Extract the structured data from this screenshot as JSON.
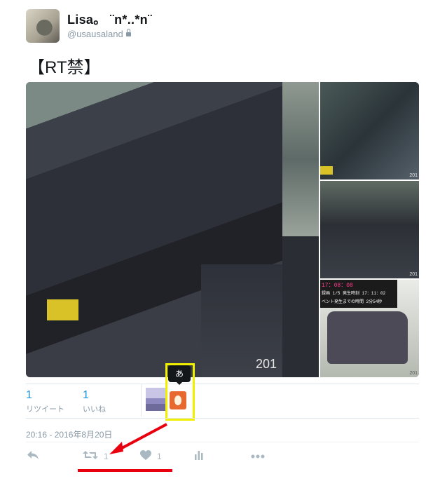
{
  "author": {
    "display_name": "Lisa。 ¨n*..*n¨",
    "handle": "@usausaland"
  },
  "tweet": {
    "text": "【RT禁】",
    "timestamp": "20:16 - 2016年8月20日"
  },
  "media": {
    "watermark_main": "201",
    "watermark_small_1": "201",
    "watermark_small_2": "201",
    "watermark_small_3": "201",
    "hud_line_1": "17：08：08",
    "hud_line_2": "録画 1/5 発生時刻 17：11：02",
    "hud_line_3": "ベント発生までの時間 2分54秒"
  },
  "stats": {
    "retweets_count": "1",
    "retweets_label": "リツイート",
    "likes_count": "1",
    "likes_label": "いいね"
  },
  "tooltip": {
    "text": "あ"
  },
  "actions": {
    "retweet_count": "1",
    "like_count": "1"
  },
  "colors": {
    "accent": "#1b95e0",
    "muted": "#8899a6",
    "annotation_red": "#e8000f",
    "annotation_yellow": "#f0f000"
  }
}
